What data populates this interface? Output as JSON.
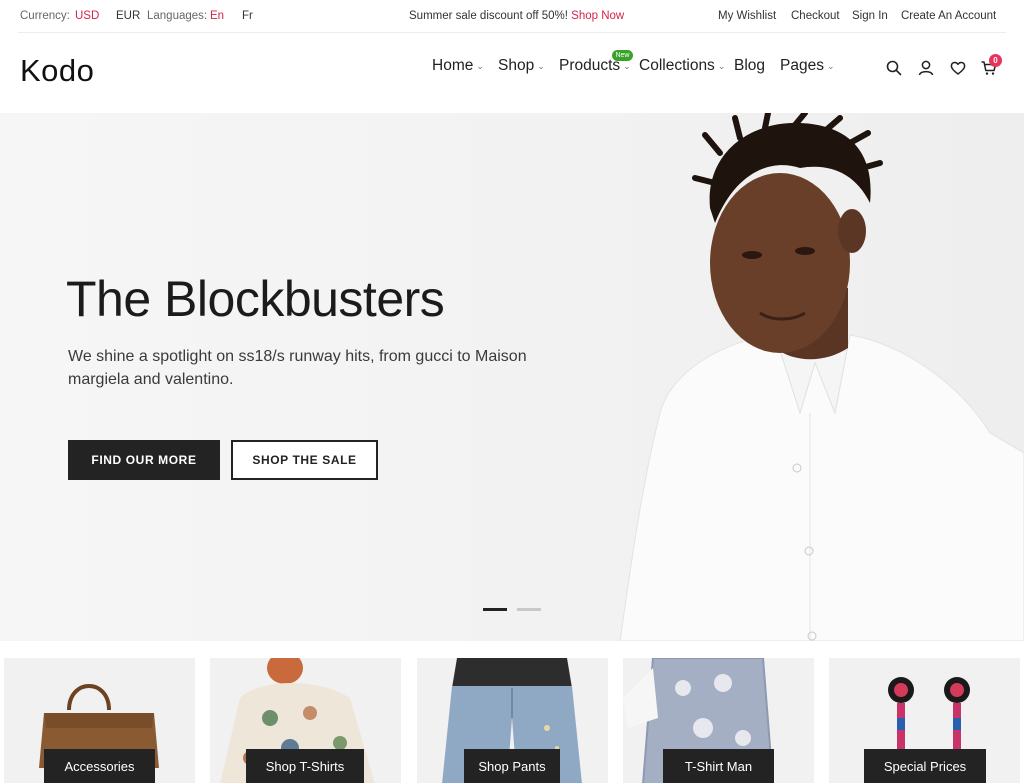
{
  "topbar": {
    "currency_label": "Currency:",
    "currency_active": "USD",
    "currency_other": "EUR",
    "languages_label": "Languages:",
    "language_active": "En",
    "language_other": "Fr",
    "promo_text": "Summer sale discount off 50%!",
    "promo_link": "Shop Now",
    "links": [
      "My Wishlist",
      "Checkout",
      "Sign In",
      "Create An Account"
    ]
  },
  "header": {
    "logo": "Kodo",
    "nav": [
      {
        "label": "Home",
        "dropdown": true
      },
      {
        "label": "Shop",
        "dropdown": true
      },
      {
        "label": "Products",
        "dropdown": true,
        "badge": "New"
      },
      {
        "label": "Collections",
        "dropdown": true
      },
      {
        "label": "Blog",
        "dropdown": false
      },
      {
        "label": "Pages",
        "dropdown": true
      }
    ],
    "icons": [
      "search-icon",
      "user-icon",
      "heart-icon",
      "cart-icon"
    ],
    "cart_count": "0"
  },
  "hero": {
    "title": "The Blockbusters",
    "subtitle": "We shine a spotlight on ss18/s runway hits, from gucci to Maison margiela and valentino.",
    "primary_button": "FIND OUR MORE",
    "secondary_button": "SHOP THE SALE",
    "slides_total": 2,
    "slide_active": 1
  },
  "categories": [
    {
      "label": "Accessories"
    },
    {
      "label": "Shop T-Shirts"
    },
    {
      "label": "Shop Pants"
    },
    {
      "label": "T-Shirt Man"
    },
    {
      "label": "Special Prices"
    }
  ],
  "colors": {
    "accent": "#d6234a",
    "dark": "#232323",
    "new_badge": "#3aa22a",
    "cart_badge": "#e8335a",
    "hero_bg": "#f3f3f3"
  }
}
